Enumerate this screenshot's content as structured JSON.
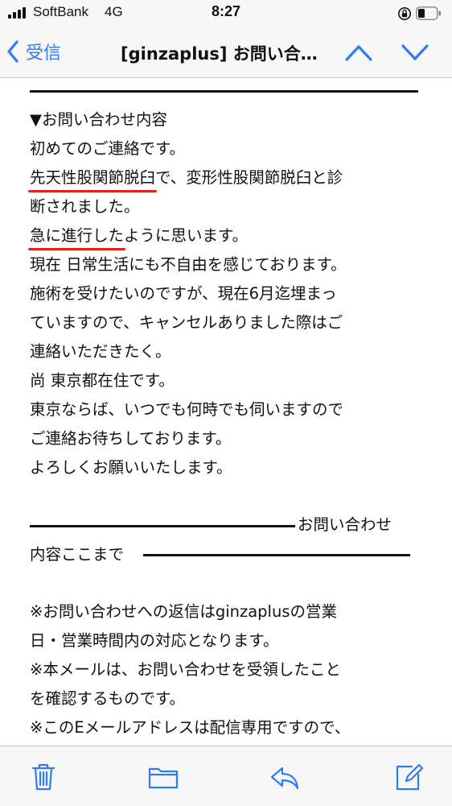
{
  "status_bar": {
    "carrier": "SoftBank",
    "network": "4G",
    "time": "8:27",
    "orientation_lock_icon": "rotation-lock-icon",
    "battery_icon": "battery-icon"
  },
  "nav": {
    "back_label": "受信",
    "title": "[ginzaplus] お問い合…",
    "icons": {
      "back": "chevron-left-icon",
      "previous": "chevron-up-icon",
      "next": "chevron-down-icon"
    }
  },
  "message": {
    "section_header": "▼お問い合わせ内容",
    "line_1": "初めてのご連絡です。",
    "line_2_highlight": "先天性股関節脱臼",
    "line_2_rest": "で、変形性股関節脱臼と診",
    "line_3": "断されました。",
    "line_4_highlight": "急に進行した",
    "line_4_rest": "ように思います。",
    "line_5": "現在 日常生活にも不自由を感じております。",
    "line_6": "施術を受けたいのですが、現在6月迄埋まっ",
    "line_7": "ていますので、キャンセルありました際はご",
    "line_8": "連絡いただきたく。",
    "line_9": "尚 東京都在住です。",
    "line_10": "東京ならば、いつでも何時でも伺いますので",
    "line_11": "ご連絡お待ちしております。",
    "line_12": "よろしくお願いいたします。",
    "end_marker_tail": "お問い合わせ",
    "end_marker_head": "内容ここまで",
    "note_1a": "※お問い合わせへの返信はginzaplusの営業",
    "note_1b": "日・営業時間内の対応となります。",
    "note_2a": "※本メールは、お問い合わせを受領したこと",
    "note_2b": "を確認するものです。",
    "note_3a": "※このEメールアドレスは配信専用ですので、",
    "highlight_color": "#e0241c"
  },
  "toolbar": {
    "icons": [
      "trash-icon",
      "folder-icon",
      "reply-icon",
      "compose-icon"
    ],
    "accent_color": "#2f7bf6"
  }
}
